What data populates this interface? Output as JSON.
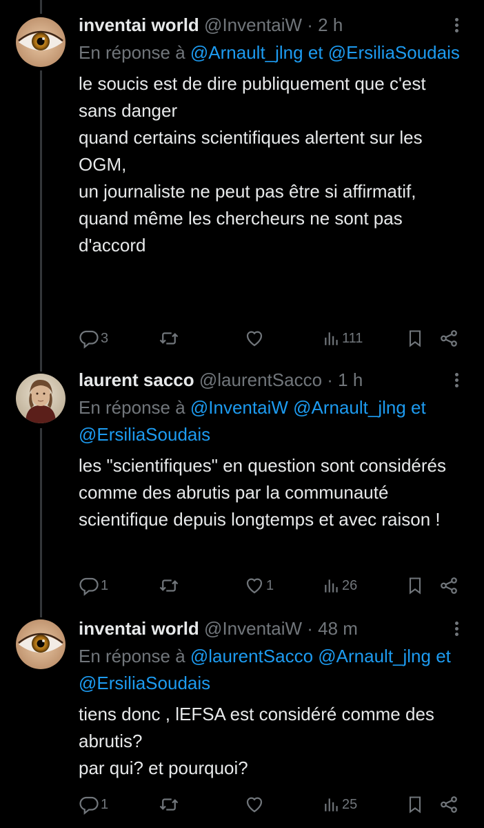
{
  "tweets": [
    {
      "name": "inventai world",
      "handle": "@InventaiW",
      "dot": " · ",
      "time": "2 h",
      "reply_prefix": "En réponse à ",
      "reply_mentions": "@Arnault_jlng et @ErsiliaSoudais",
      "body": "le soucis est de dire publiquement que c'est sans danger\nquand certains scientifiques  alertent sur les OGM,\nun journaliste ne peut pas être si affirmatif,\nquand même les chercheurs ne sont pas d'accord",
      "replies": "3",
      "reposts": "",
      "likes": "",
      "views": "111",
      "avatar": "eye-avatar"
    },
    {
      "name": "laurent sacco",
      "handle": "@laurentSacco",
      "dot": " · ",
      "time": "1 h",
      "reply_prefix": "En réponse à ",
      "reply_mentions": "@InventaiW @Arnault_jlng et @ErsiliaSoudais",
      "body": "les \"scientifiques\" en question sont considérés comme des abrutis par la communauté scientifique depuis longtemps et avec raison !",
      "replies": "1",
      "reposts": "",
      "likes": "1",
      "views": "26",
      "avatar": "portrait-avatar"
    },
    {
      "name": "inventai world",
      "handle": "@InventaiW",
      "dot": " · ",
      "time": "48 m",
      "reply_prefix": "En réponse à ",
      "reply_mentions": "@laurentSacco @Arnault_jlng et @ErsiliaSoudais",
      "body": "tiens donc , lEFSA est considéré comme des abrutis?\npar qui? et pourquoi?",
      "replies": "1",
      "reposts": "",
      "likes": "",
      "views": "25",
      "avatar": "eye-avatar"
    }
  ],
  "colors": {
    "background": "#000000",
    "text": "#e7e9ea",
    "muted": "#71767b",
    "link": "#1d9bf0",
    "thread_line": "#333639"
  },
  "icons": [
    "reply-icon",
    "repost-icon",
    "like-icon",
    "views-icon",
    "bookmark-icon",
    "share-icon",
    "more-icon"
  ]
}
